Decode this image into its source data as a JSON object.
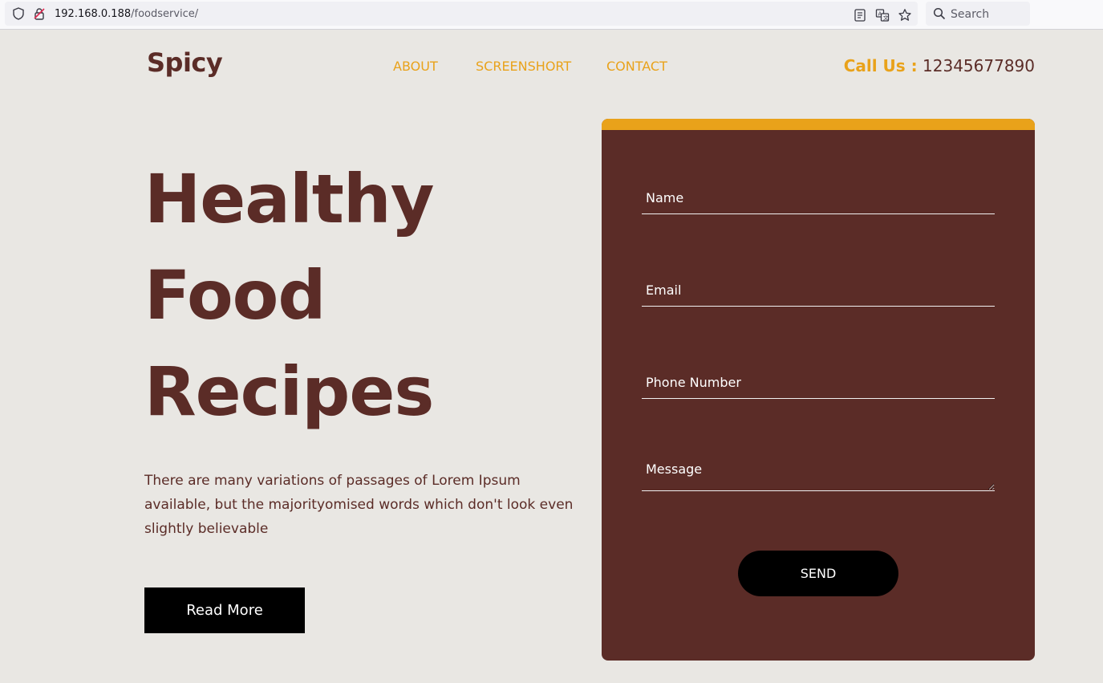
{
  "browser": {
    "url_host": "192.168.0.188",
    "url_path": "/foodservice/",
    "search_placeholder": "Search"
  },
  "header": {
    "logo": "Spicy",
    "nav": [
      "ABOUT",
      "SCREENSHORT",
      "CONTACT"
    ],
    "call_label": "Call Us :",
    "call_number": "12345677890"
  },
  "hero": {
    "title_lines": [
      "Healthy",
      "Food",
      "Recipes"
    ],
    "description": "There are many variations of passages of Lorem Ipsum available, but the majorityomised words which don't look even slightly believable",
    "cta": "Read More"
  },
  "form": {
    "name_placeholder": "Name",
    "email_placeholder": "Email",
    "phone_placeholder": "Phone Number",
    "message_placeholder": "Message",
    "submit": "SEND"
  },
  "colors": {
    "brand": "#5b2c27",
    "accent": "#e9a21a",
    "background": "#e9e7e3"
  }
}
